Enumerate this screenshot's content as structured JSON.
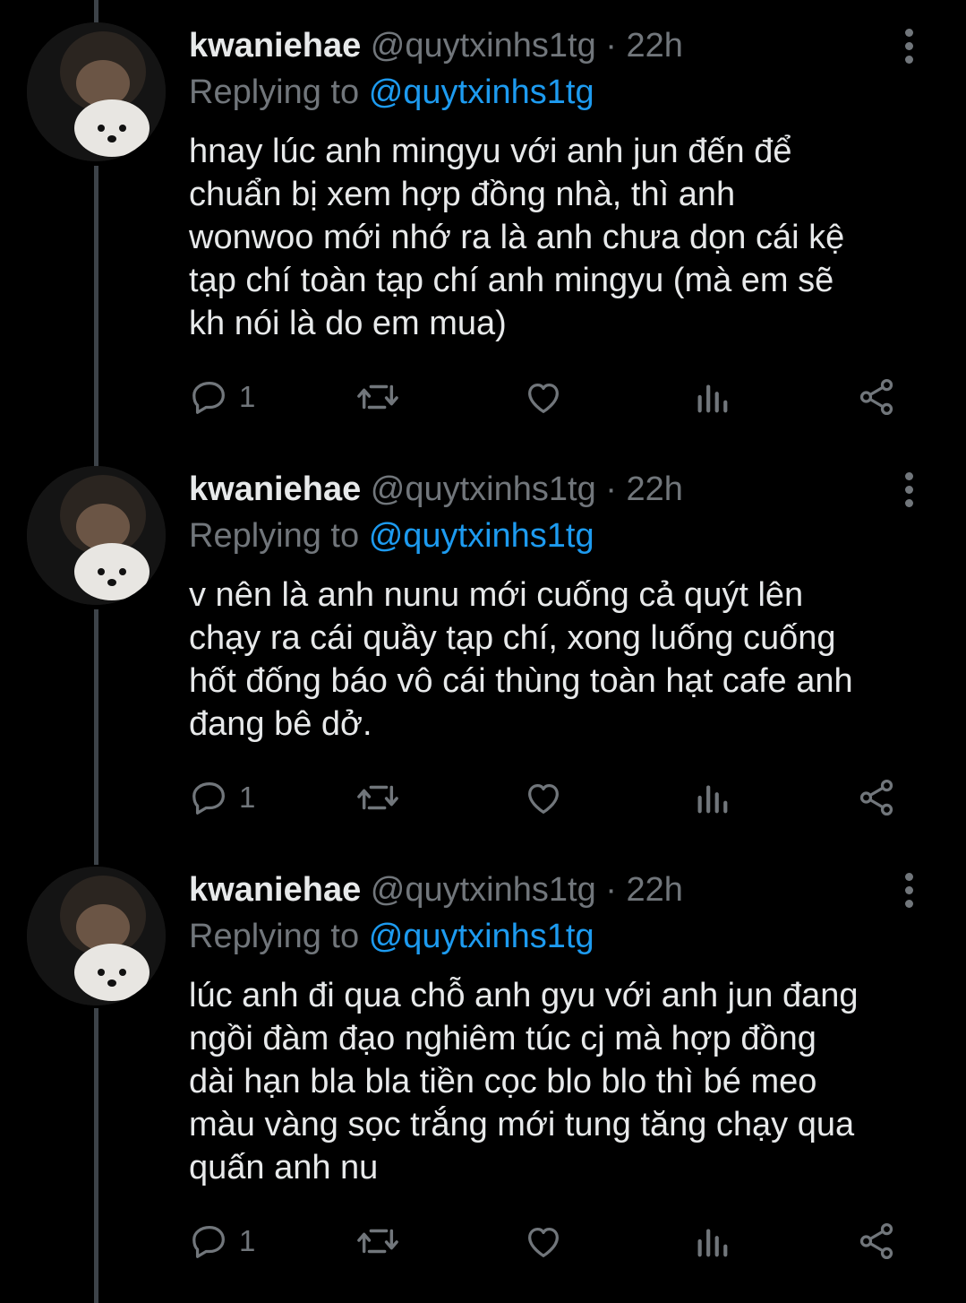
{
  "tweets": [
    {
      "author_name": "kwaniehae",
      "handle": "@quytxinhs1tg",
      "separator": "·",
      "time": "22h",
      "replying_prefix": "Replying to",
      "replying_to": "@quytxinhs1tg",
      "lines": [
        "hnay lúc anh mingyu với anh jun đến để",
        "chuẩn bị xem hợp đồng nhà, thì anh",
        "wonwoo mới nhớ ra là anh chưa dọn cái kệ",
        "tạp chí toàn tạp chí anh mingyu (mà em sẽ",
        "kh nói là do em mua)"
      ],
      "reply_count": "1"
    },
    {
      "author_name": "kwaniehae",
      "handle": "@quytxinhs1tg",
      "separator": "·",
      "time": "22h",
      "replying_prefix": "Replying to",
      "replying_to": "@quytxinhs1tg",
      "lines": [
        "v nên là anh nunu mới cuống cả quýt lên",
        "chạy ra cái quầy tạp chí, xong luống cuống",
        "hốt đống báo vô cái thùng toàn hạt cafe anh",
        "đang bê dở."
      ],
      "reply_count": "1"
    },
    {
      "author_name": "kwaniehae",
      "handle": "@quytxinhs1tg",
      "separator": "·",
      "time": "22h",
      "replying_prefix": "Replying to",
      "replying_to": "@quytxinhs1tg",
      "lines": [
        "lúc anh đi qua chỗ anh gyu với anh jun đang",
        "ngồi đàm đạo nghiêm túc cj mà hợp đồng",
        "dài hạn bla bla tiền cọc blo blo thì bé meo",
        "màu vàng sọc trắng mới tung tăng chạy qua",
        "quấn anh nu"
      ],
      "reply_count": "1"
    }
  ],
  "icons": {
    "reply": "reply-icon",
    "retweet": "retweet-icon",
    "like": "heart-icon",
    "analytics": "analytics-icon",
    "share": "share-icon",
    "more": "more-vertical-icon"
  },
  "colors": {
    "background": "#000000",
    "text": "#e7e9ea",
    "muted": "#71767b",
    "link": "#1d9bf0",
    "thread_line": "#3d4349"
  }
}
